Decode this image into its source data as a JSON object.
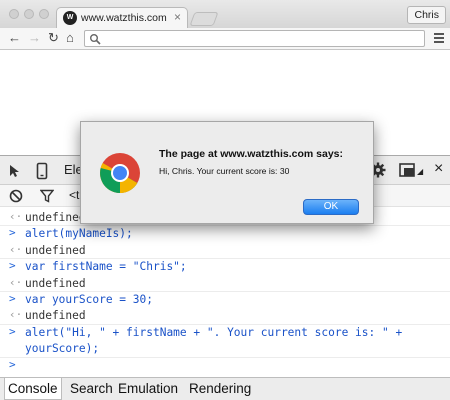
{
  "browser": {
    "tab_title": "www.watzthis.com",
    "tab_favicon_text": "W",
    "profile_name": "Chris",
    "address_value": ""
  },
  "devtools": {
    "panel_label": "Ele",
    "filter_partial": "<t"
  },
  "console": {
    "lines": [
      {
        "kind": "output",
        "prefix": "‹·",
        "text": "undefined"
      },
      {
        "kind": "input",
        "prefix": ">",
        "text": "alert(myNameIs);"
      },
      {
        "kind": "output",
        "prefix": "‹·",
        "text": "undefined"
      },
      {
        "kind": "input",
        "prefix": ">",
        "text": "var firstName = \"Chris\";"
      },
      {
        "kind": "output",
        "prefix": "‹·",
        "text": "undefined"
      },
      {
        "kind": "input",
        "prefix": ">",
        "text": "var yourScore = 30;"
      },
      {
        "kind": "output",
        "prefix": "‹·",
        "text": "undefined"
      },
      {
        "kind": "input",
        "prefix": ">",
        "text": "alert(\"Hi, \" + firstName + \". Your current score is: \" +"
      },
      {
        "kind": "input-cont",
        "prefix": "",
        "text": "yourScore);"
      },
      {
        "kind": "prompt",
        "prefix": ">",
        "text": ""
      }
    ]
  },
  "drawer": {
    "tabs": [
      "Console",
      "Search",
      "Emulation",
      "Rendering"
    ]
  },
  "dialog": {
    "title": "The page at www.watzthis.com says:",
    "message": "Hi, Chris. Your current score is: 30",
    "ok_label": "OK"
  },
  "colors": {
    "input_text": "#1a52c8",
    "ok_button": "#1b7ef0"
  }
}
